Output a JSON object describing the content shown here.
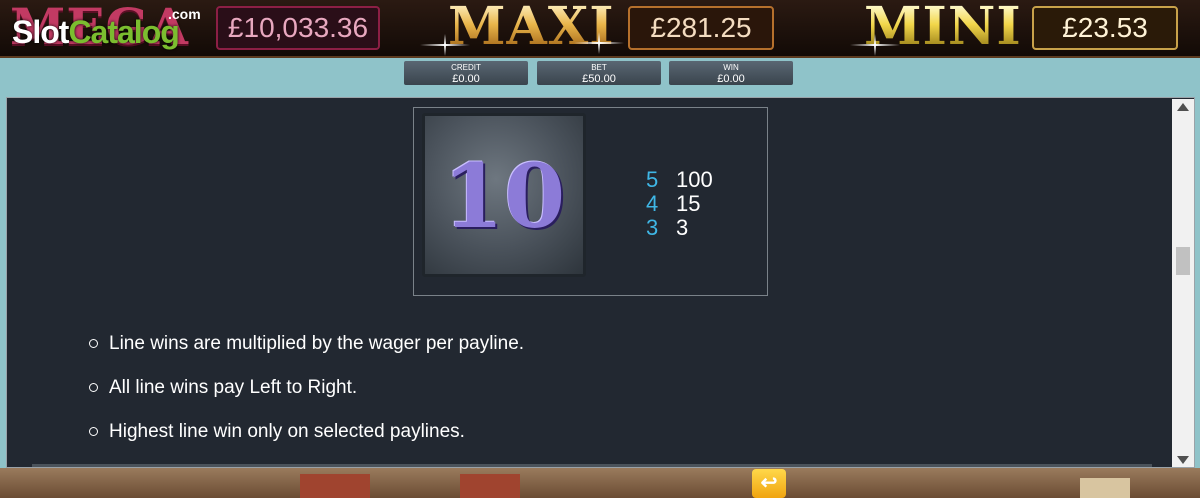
{
  "jackpots": {
    "mega": {
      "label": "MEGA",
      "value": "£10,033.36"
    },
    "maxi": {
      "label": "MAXI",
      "value": "£281.25"
    },
    "mini": {
      "label": "MINI",
      "value": "£23.53"
    }
  },
  "watermark": {
    "part1": "Slot",
    "part2": "Catalog",
    "suffix": ".com"
  },
  "stats": {
    "credit": {
      "label": "CREDIT",
      "value": "£0.00"
    },
    "bet": {
      "label": "BET",
      "value": "£50.00"
    },
    "win": {
      "label": "WIN",
      "value": "£0.00"
    }
  },
  "paytable": {
    "symbol": "10",
    "pays": [
      {
        "count": "5",
        "amount": "100"
      },
      {
        "count": "4",
        "amount": "15"
      },
      {
        "count": "3",
        "amount": "3"
      }
    ]
  },
  "rules": [
    "Line wins are multiplied by the wager per payline.",
    "All line wins pay Left to Right.",
    "Highest line win only on selected paylines."
  ],
  "controls": {
    "back_icon": "back-arrow-icon",
    "back_glyph": "↩"
  },
  "colors": {
    "pay_count": "#3fb7e6",
    "panel_bg": "#222831",
    "mega": "#c23a63"
  }
}
